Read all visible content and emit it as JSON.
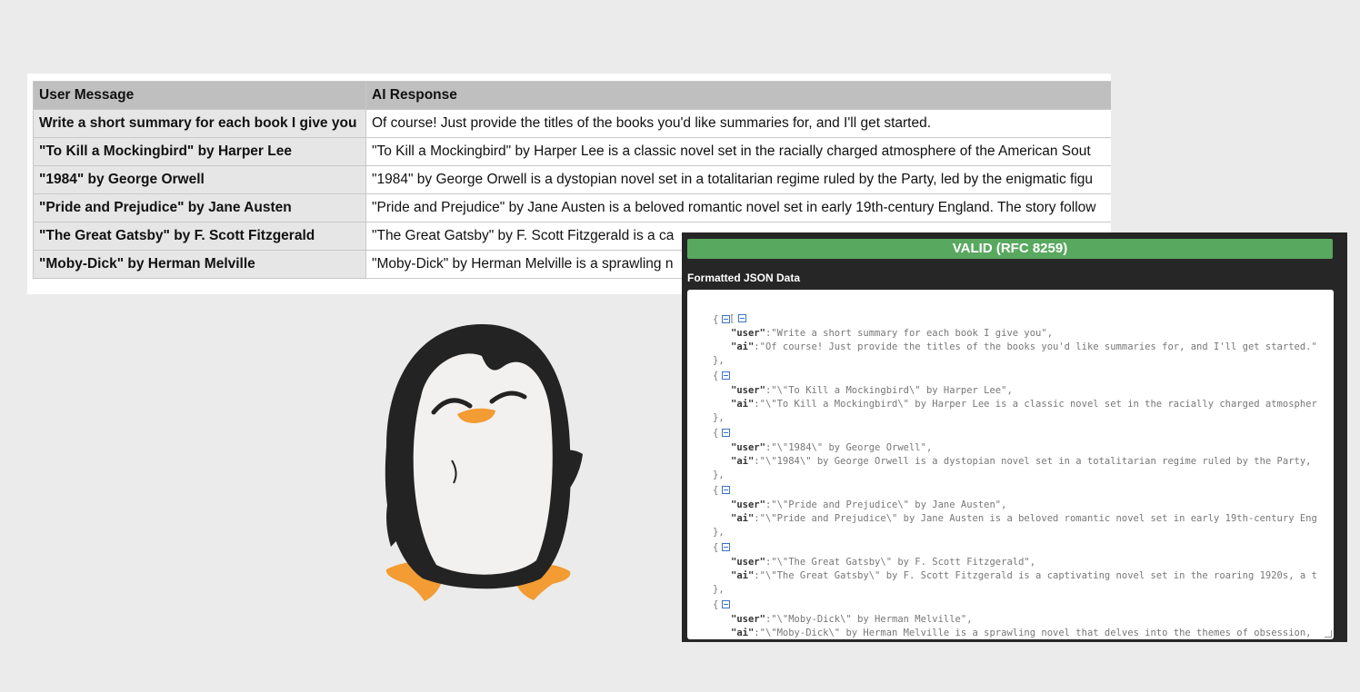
{
  "table": {
    "headers": {
      "user": "User Message",
      "ai": "AI Response"
    },
    "rows": [
      {
        "user": "Write a short summary for each book I give you",
        "ai": "Of course! Just provide the titles of the books you'd like summaries for, and I'll get started."
      },
      {
        "user": "\"To Kill a Mockingbird\" by Harper Lee",
        "ai": "\"To Kill a Mockingbird\" by Harper Lee is a classic novel set in the racially charged atmosphere of the American Sout"
      },
      {
        "user": "\"1984\" by George Orwell",
        "ai": "\"1984\" by George Orwell is a dystopian novel set in a totalitarian regime ruled by the Party, led by the enigmatic figu"
      },
      {
        "user": "\"Pride and Prejudice\" by Jane Austen",
        "ai": "\"Pride and Prejudice\" by Jane Austen is a beloved romantic novel set in early 19th-century England. The story follow"
      },
      {
        "user": "\"The Great Gatsby\" by F. Scott Fitzgerald",
        "ai": "\"The Great Gatsby\" by F. Scott Fitzgerald is a ca"
      },
      {
        "user": "\"Moby-Dick\" by Herman Melville",
        "ai": "\"Moby-Dick\" by Herman Melville is a sprawling n"
      }
    ]
  },
  "json_panel": {
    "status": "VALID (RFC 8259)",
    "label": "Formatted JSON Data",
    "open_bracket": "[",
    "open_brace": "{",
    "close_brace": "},",
    "key_user": "\"user\"",
    "key_ai": "\"ai\"",
    "entries": [
      {
        "user": ":\"Write a short summary for each book I give you\",",
        "ai": ":\"Of course! Just provide the titles of the books you'd like summaries for, and I'll get started.\""
      },
      {
        "user": ":\"\\\"To Kill a Mockingbird\\\" by Harper Lee\",",
        "ai": ":\"\\\"To Kill a Mockingbird\\\" by Harper Lee is a classic novel set in the racially charged atmospher"
      },
      {
        "user": ":\"\\\"1984\\\" by George Orwell\",",
        "ai": ":\"\\\"1984\\\" by George Orwell is a dystopian novel set in a totalitarian regime ruled by the Party,"
      },
      {
        "user": ":\"\\\"Pride and Prejudice\\\" by Jane Austen\",",
        "ai": ":\"\\\"Pride and Prejudice\\\" by Jane Austen is a beloved romantic novel set in early 19th-century Eng"
      },
      {
        "user": ":\"\\\"The Great Gatsby\\\" by F. Scott Fitzgerald\",",
        "ai": ":\"\\\"The Great Gatsby\\\" by F. Scott Fitzgerald is a captivating novel set in the roaring 1920s, a t"
      },
      {
        "user": ":\"\\\"Moby-Dick\\\" by Herman Melville\",",
        "ai": ":\"\\\"Moby-Dick\\\" by Herman Melville is a sprawling novel that delves into the themes of obsession,"
      }
    ],
    "zoom": {
      "out": "−",
      "in": "+",
      "fullscreen": "⛶"
    }
  },
  "colors": {
    "valid": "#58a85f",
    "panel_bg": "#262626",
    "penguin_beak": "#f39b2f"
  },
  "icons": [
    "collapse-toggle-icon",
    "zoom-out-icon",
    "zoom-in-icon",
    "fullscreen-icon",
    "penguin-illustration"
  ]
}
